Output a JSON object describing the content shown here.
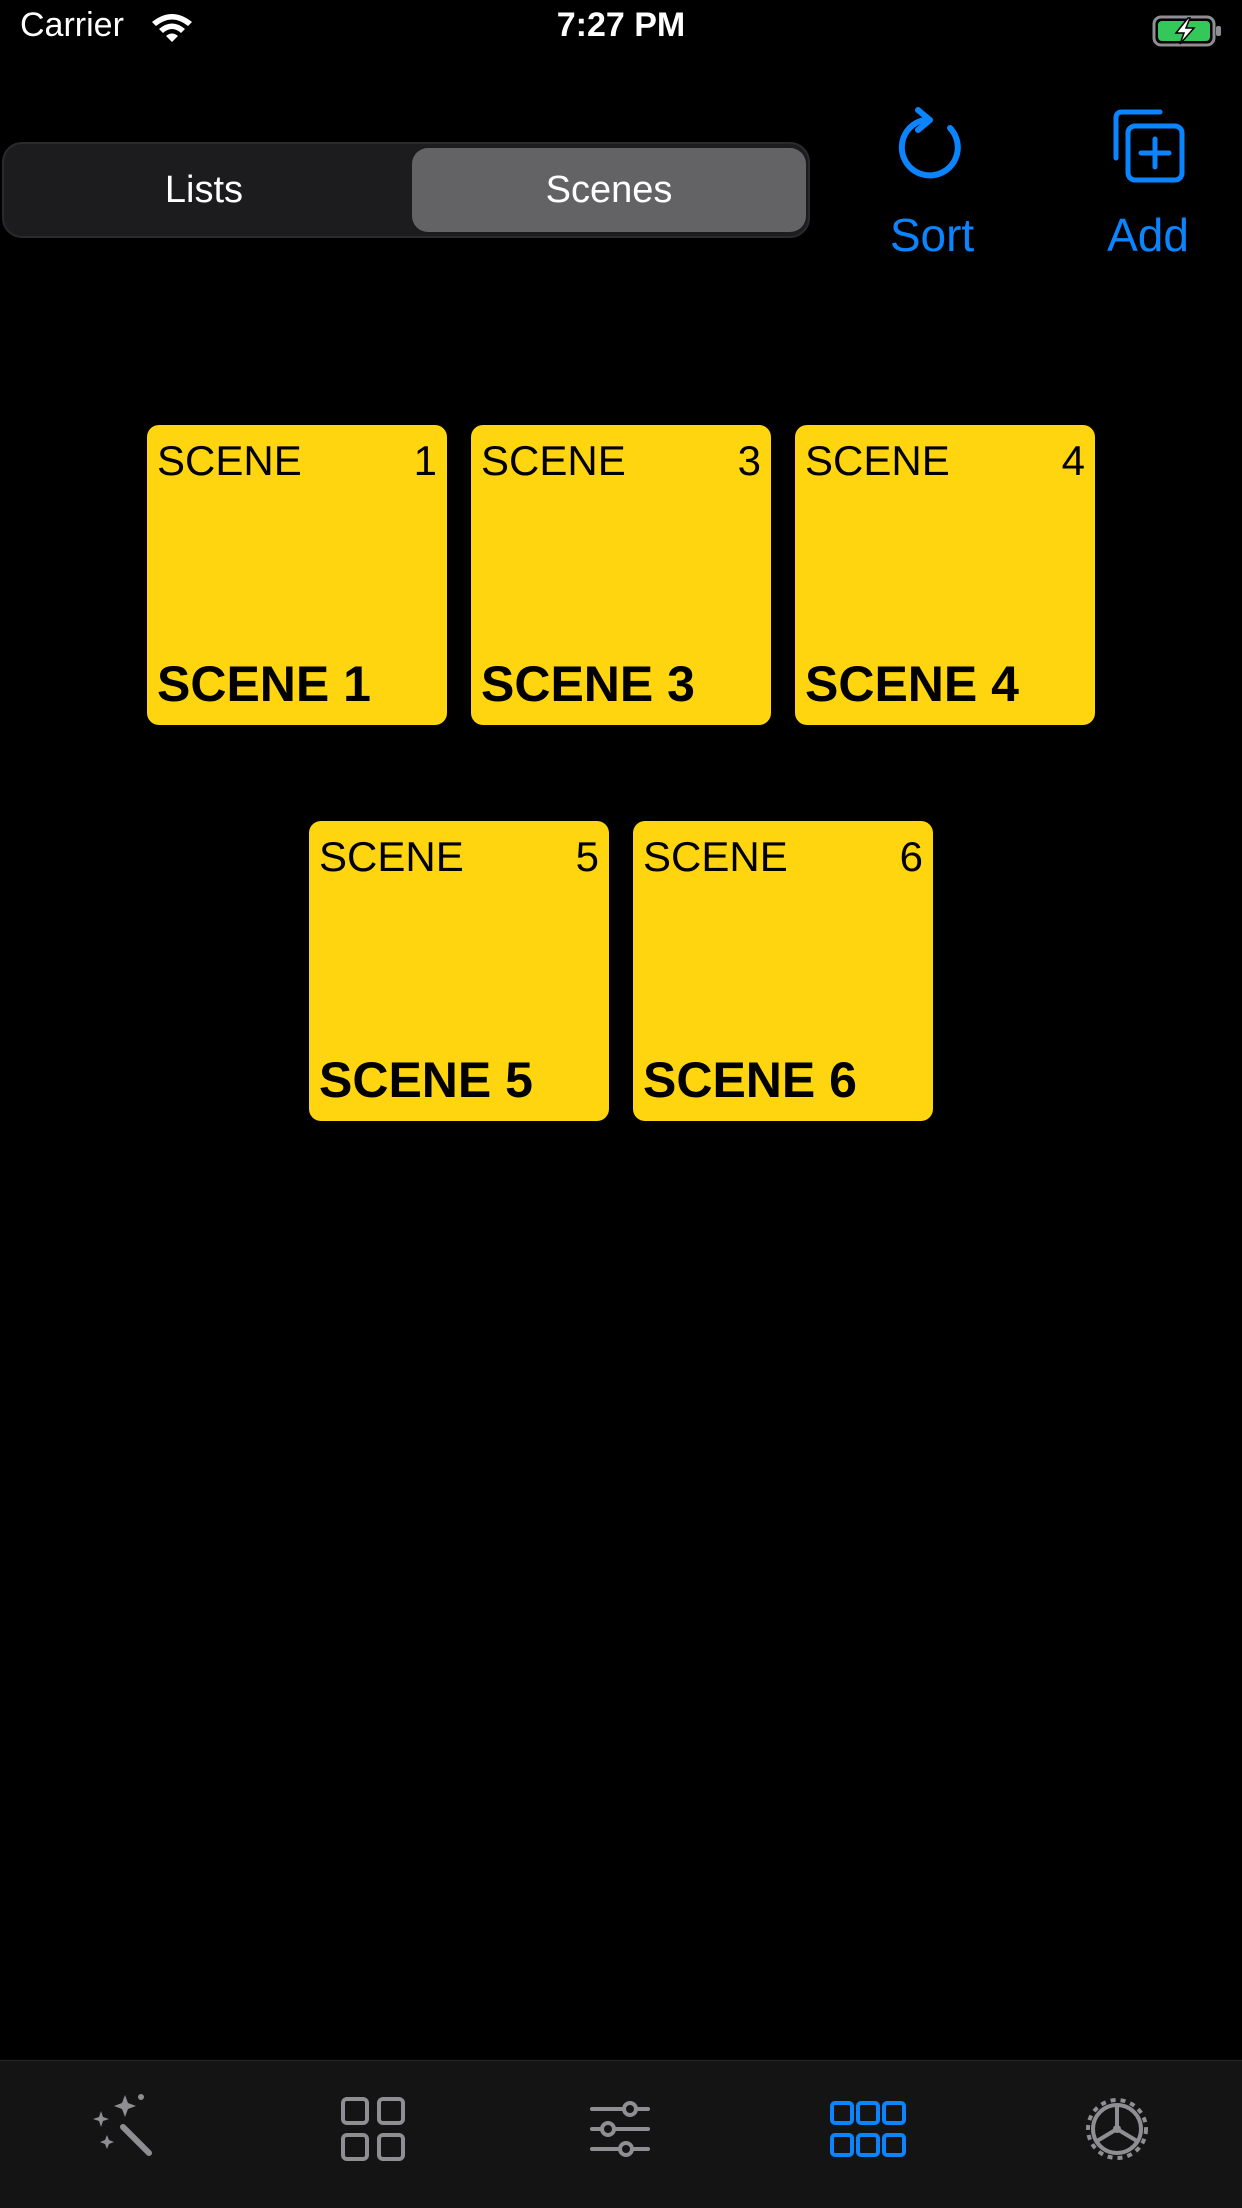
{
  "status_bar": {
    "carrier": "Carrier",
    "time": "7:27 PM"
  },
  "segmented_control": {
    "segments": [
      "Lists",
      "Scenes"
    ],
    "selected": "Scenes"
  },
  "toolbar": {
    "sort_label": "Sort",
    "add_label": "Add",
    "accent_color": "#0a84ff"
  },
  "scenes": [
    {
      "type": "SCENE",
      "number": "1",
      "name": "SCENE 1"
    },
    {
      "type": "SCENE",
      "number": "3",
      "name": "SCENE 3"
    },
    {
      "type": "SCENE",
      "number": "4",
      "name": "SCENE 4"
    },
    {
      "type": "SCENE",
      "number": "5",
      "name": "SCENE 5"
    },
    {
      "type": "SCENE",
      "number": "6",
      "name": "SCENE 6"
    }
  ],
  "tile_color": "#fed50f",
  "tab_bar": {
    "tabs": [
      {
        "icon": "magic-wand-icon",
        "selected": false
      },
      {
        "icon": "grid-2x2-icon",
        "selected": false
      },
      {
        "icon": "sliders-icon",
        "selected": false
      },
      {
        "icon": "grid-3x2-icon",
        "selected": true
      },
      {
        "icon": "settings-wheel-icon",
        "selected": false
      }
    ],
    "active_color": "#0a84ff",
    "inactive_color": "#8e8e93"
  }
}
